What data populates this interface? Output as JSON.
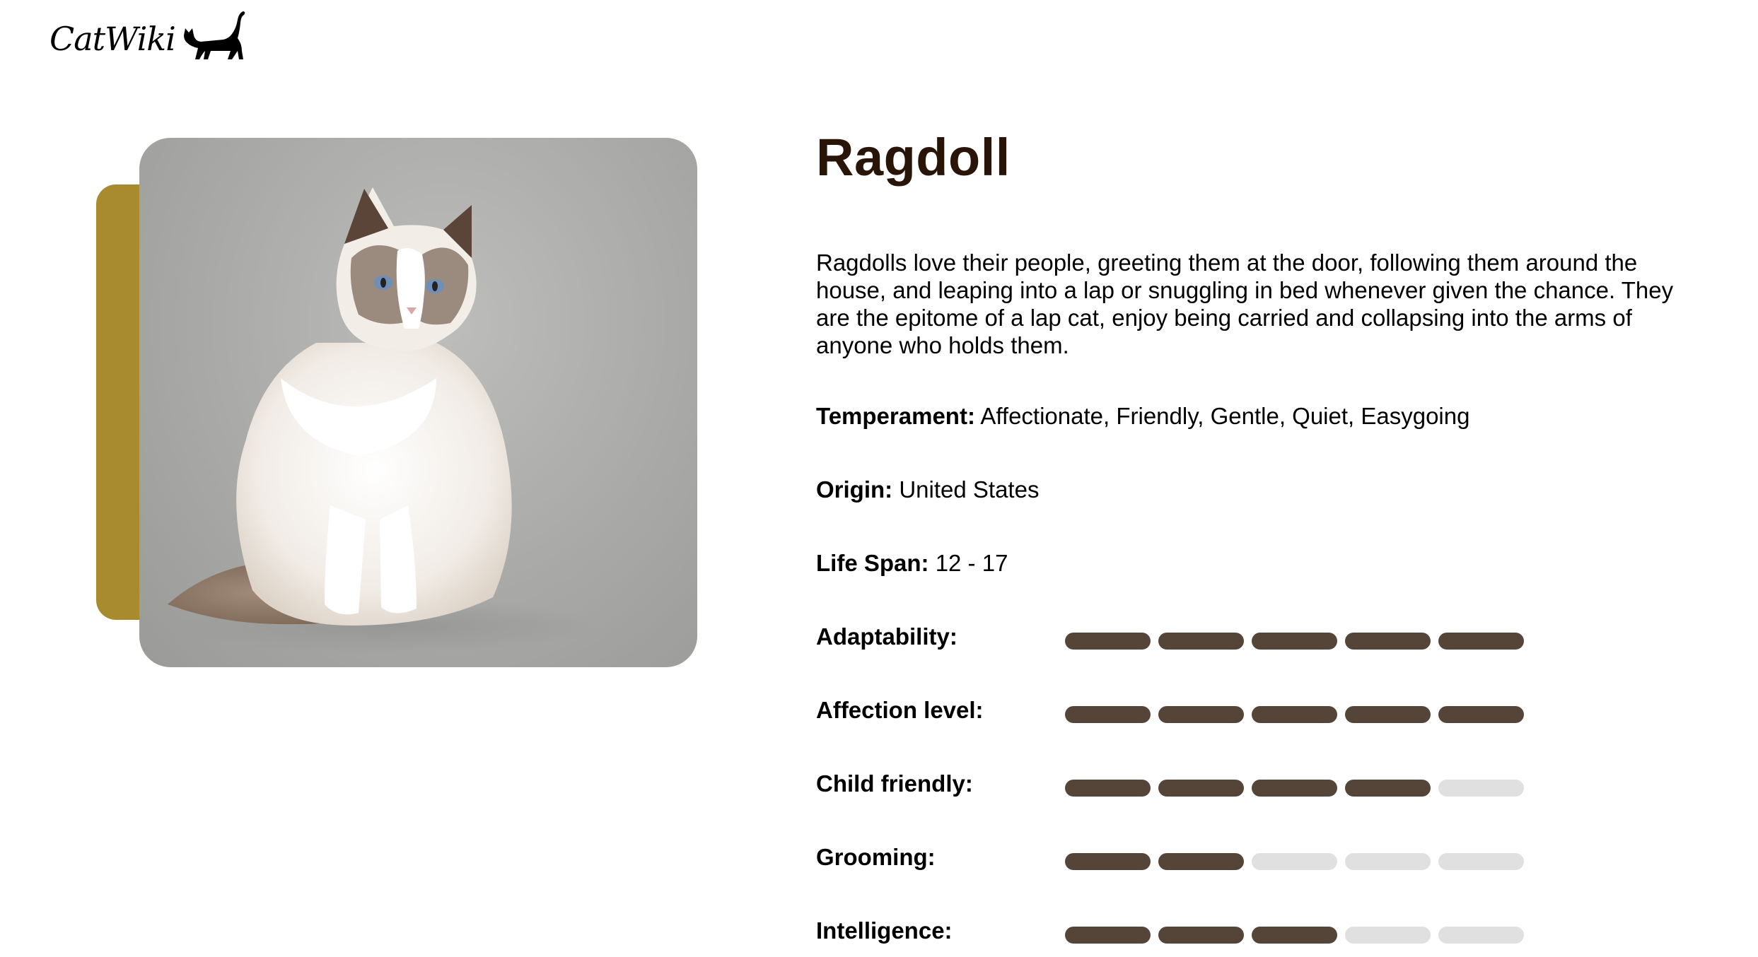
{
  "brand": {
    "name": "CatWiki"
  },
  "breed": {
    "name": "Ragdoll",
    "description": "Ragdolls love their people, greeting them at the door, following them around the house, and leaping into a lap or snuggling in bed whenever given the chance. They are the epitome of a lap cat, enjoy being carried and collapsing into the arms of anyone who holds them.",
    "temperament_label": "Temperament:",
    "temperament": "Affectionate, Friendly, Gentle, Quiet, Easygoing",
    "origin_label": "Origin:",
    "origin": "United States",
    "life_span_label": "Life Span:",
    "life_span": "12 - 17"
  },
  "ratings": [
    {
      "label": "Adaptability:",
      "value": 5,
      "max": 5
    },
    {
      "label": "Affection level:",
      "value": 5,
      "max": 5
    },
    {
      "label": "Child friendly:",
      "value": 4,
      "max": 5
    },
    {
      "label": "Grooming:",
      "value": 2,
      "max": 5
    },
    {
      "label": "Intelligence:",
      "value": 3,
      "max": 5
    }
  ],
  "colors": {
    "accent": "#A88A2F",
    "bar_filled": "#544538",
    "bar_empty": "#E0E0E0",
    "title": "#291507"
  },
  "icons": {
    "logo": "cat-silhouette-icon",
    "photo": "ragdoll-cat-photo"
  }
}
